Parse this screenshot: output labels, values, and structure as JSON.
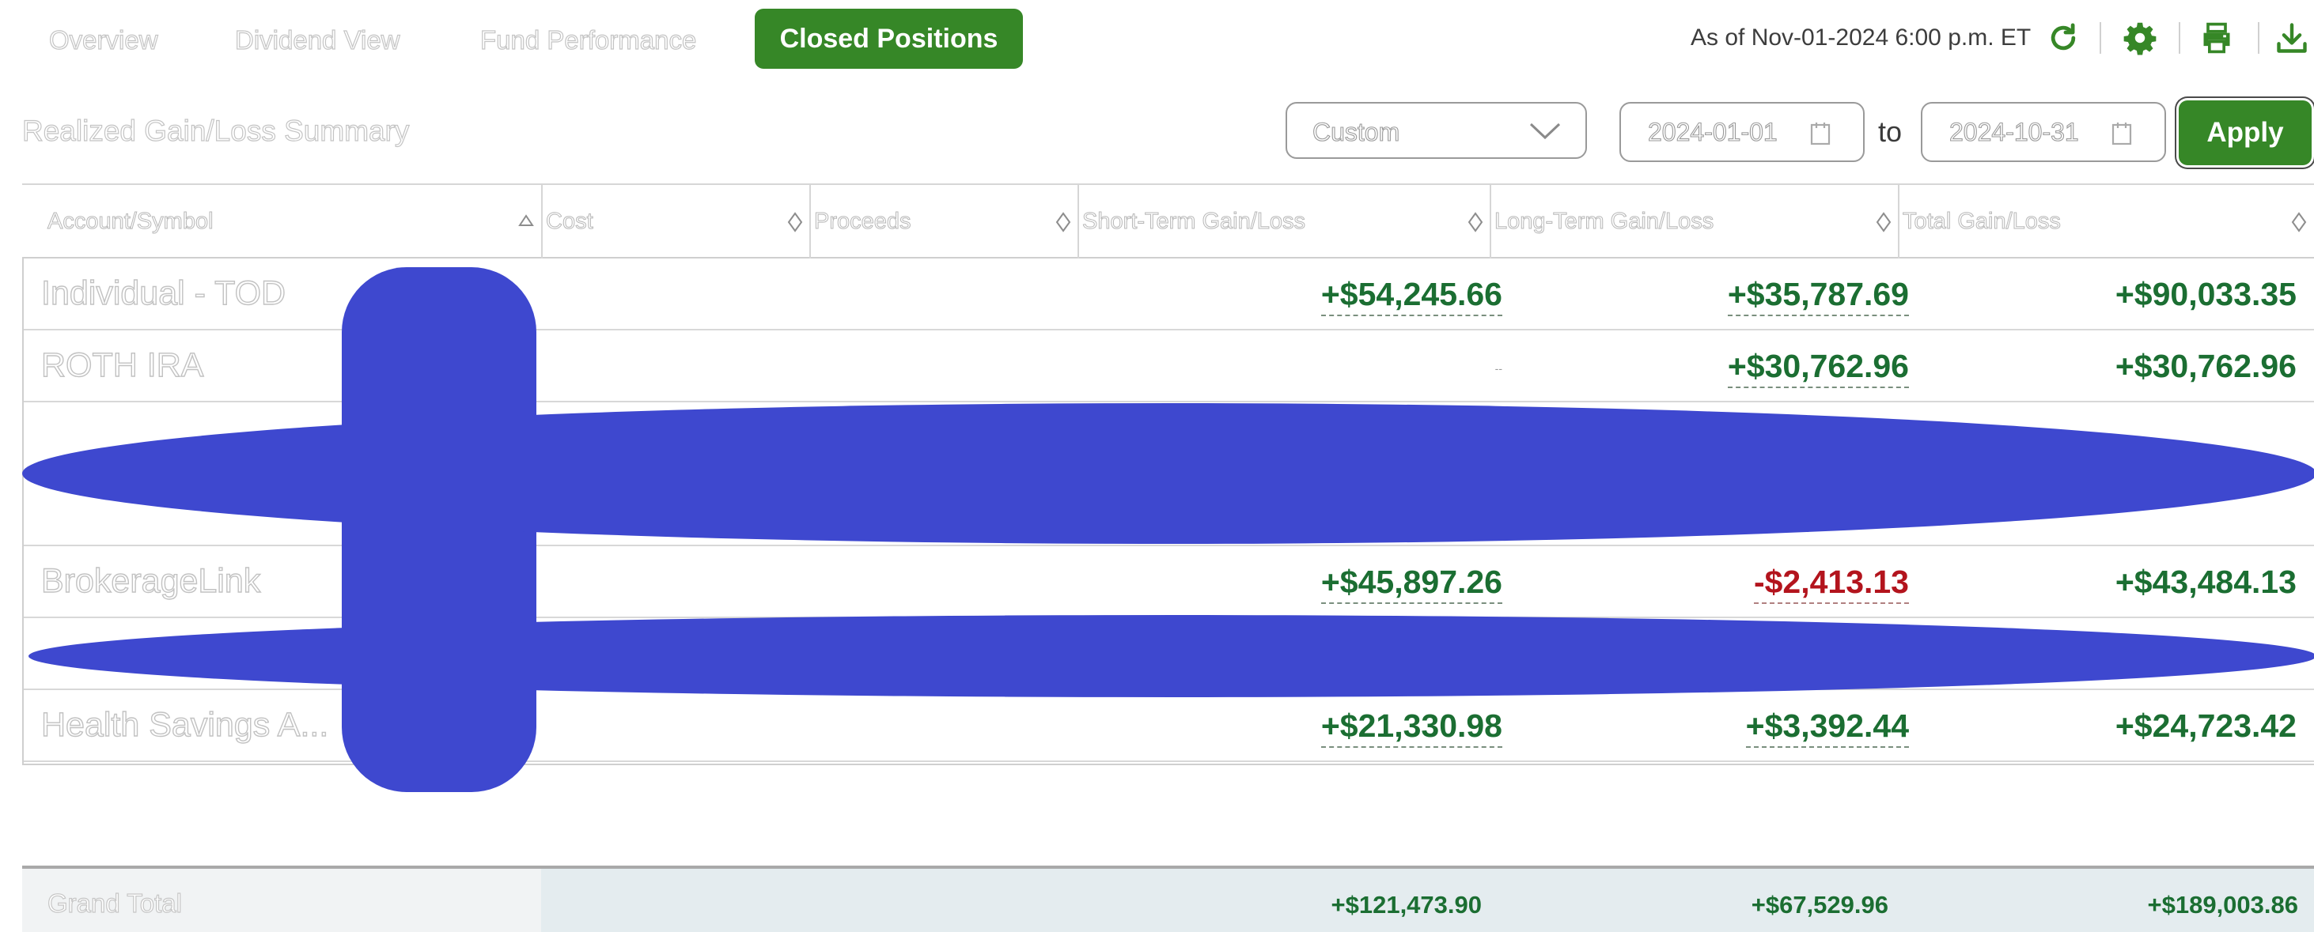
{
  "nav": {
    "tabs": [
      {
        "label": "Overview"
      },
      {
        "label": "Dividend View"
      },
      {
        "label": "Fund Performance"
      }
    ],
    "active_tab": "Closed Positions",
    "as_of": "As of Nov-01-2024 6:00 p.m. ET"
  },
  "toolbar": {
    "refresh_icon": "refresh-icon",
    "settings_icon": "gear-icon",
    "print_icon": "printer-icon",
    "download_icon": "download-icon"
  },
  "summary": {
    "title": "Realized Gain/Loss Summary",
    "period_select": "Custom",
    "start_date": "2024-01-01",
    "to_label": "to",
    "end_date": "2024-10-31",
    "apply_label": "Apply"
  },
  "table": {
    "columns": [
      "Account/Symbol",
      "Cost",
      "Proceeds",
      "Short-Term Gain/Loss",
      "Long-Term Gain/Loss",
      "Total Gain/Loss"
    ],
    "rows": [
      {
        "account": "Individual - TOD",
        "short_term": "+$54,245.66",
        "long_term": "+$35,787.69",
        "total": "+$90,033.35"
      },
      {
        "account": "ROTH IRA",
        "short_term": "--",
        "long_term": "+$30,762.96",
        "total": "+$30,762.96"
      },
      {
        "account": "BrokerageLink",
        "short_term": "+$45,897.26",
        "long_term": "-$2,413.13",
        "total": "+$43,484.13"
      },
      {
        "account": "Health Savings A...",
        "short_term": "+$21,330.98",
        "long_term": "+$3,392.44",
        "total": "+$24,723.42"
      }
    ],
    "grand_total": {
      "label": "Grand Total",
      "short_term": "+$121,473.90",
      "long_term": "+$67,529.96",
      "total": "+$189,003.86"
    }
  },
  "colors": {
    "accent_green": "#368727",
    "gain_green": "#1b6e32",
    "loss_red": "#b3141d",
    "redaction_blue": "#3e48cf"
  }
}
